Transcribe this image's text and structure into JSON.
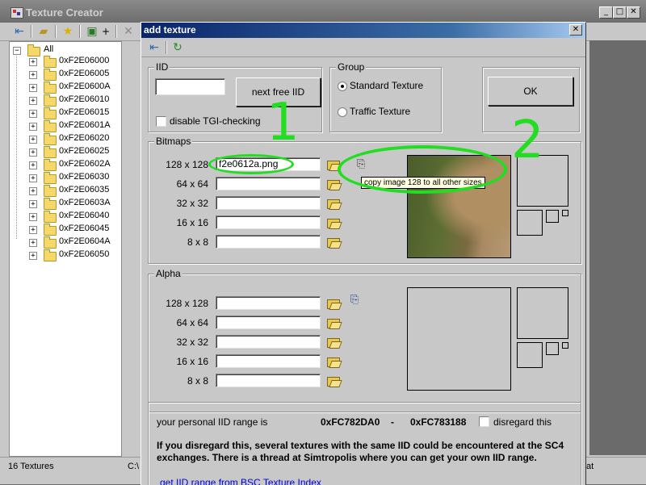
{
  "main_window": {
    "title": "Texture Creator",
    "window_buttons": [
      "_",
      "□",
      "✕"
    ],
    "toolbar": {
      "plus_label": "+"
    },
    "tree": {
      "root": "All",
      "items": [
        "0xF2E06000",
        "0xF2E06005",
        "0xF2E0600A",
        "0xF2E06010",
        "0xF2E06015",
        "0xF2E0601A",
        "0xF2E06020",
        "0xF2E06025",
        "0xF2E0602A",
        "0xF2E06030",
        "0xF2E06035",
        "0xF2E0603A",
        "0xF2E06040",
        "0xF2E06045",
        "0xF2E0604A",
        "0xF2E06050"
      ]
    },
    "status": {
      "count": "16 Textures",
      "path_fragment": "C:\\",
      "right_fragment": "at"
    }
  },
  "dialog": {
    "title": "add texture",
    "close": "✕",
    "iid_group": {
      "label": "IID",
      "value": "",
      "next_free_button": "next free IID",
      "disable_tgi_label": "disable TGI-checking"
    },
    "group_group": {
      "label": "Group",
      "options": [
        "Standard Texture",
        "Traffic Texture"
      ],
      "selected": "Standard Texture"
    },
    "ok_button": "OK",
    "bitmaps": {
      "label": "Bitmaps",
      "sizes": [
        "128 x 128",
        "64 x 64",
        "32 x 32",
        "16 x 16",
        "8 x 8"
      ],
      "values": [
        "f2e0612a.png",
        "",
        "",
        "",
        ""
      ],
      "tooltip": "copy image 128 to all other sizes"
    },
    "alpha": {
      "label": "Alpha",
      "sizes": [
        "128 x 128",
        "64 x 64",
        "32 x 32",
        "16 x 16",
        "8 x 8"
      ],
      "values": [
        "",
        "",
        "",
        "",
        ""
      ]
    },
    "iid_range": {
      "label": "your personal IID range is",
      "start": "0xFC782DA0",
      "dash": "-",
      "end": "0xFC783188",
      "disregard_label": "disregard this",
      "warning": "If you disregard this, several textures with the same IID could be encountered at the SC4 exchanges. There is a thread at Simtropolis where you can get your own IID range.",
      "link": "get IID range from BSC Texture Index"
    }
  },
  "annotations": {
    "one": "1",
    "two": "2"
  },
  "colors": {
    "annotation_green": "#22dd22",
    "dialog_title_start": "#0a246a",
    "main_bg": "#c8c8c8"
  }
}
